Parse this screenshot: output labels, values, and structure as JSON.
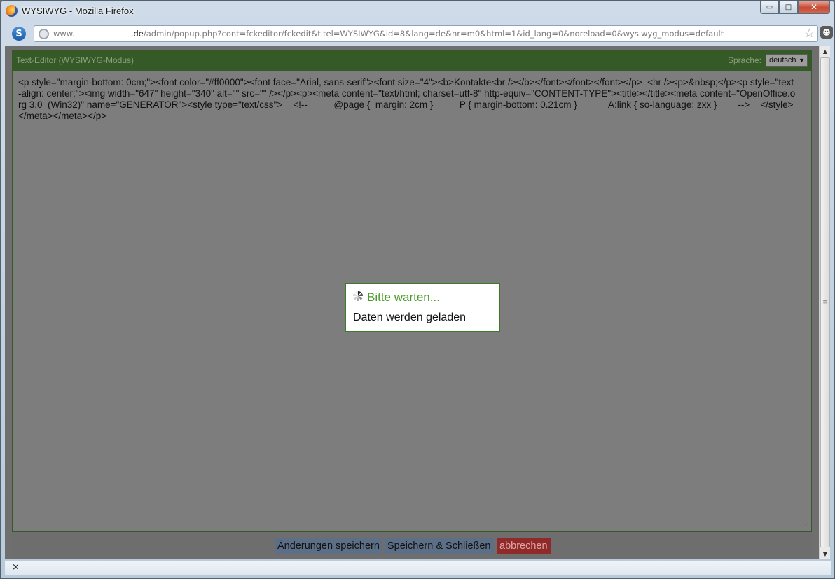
{
  "window": {
    "title": "WYSIWYG - Mozilla Firefox",
    "minimize_glyph": "▭",
    "maximize_glyph": "□",
    "close_glyph": "✕"
  },
  "navbar": {
    "url_prefix": "www.",
    "url_host": ".de",
    "url_path": "/admin/popup.php?cont=fckeditor/fckedit&titel=WYSIWYG&id=8&lang=de&nr=m0&html=1&id_lang=0&noreload=0&wysiwyg_modus=default",
    "site_icon_letter": "S",
    "bookmark_glyph": "☆"
  },
  "editor": {
    "title": "Text-Editor (WYSIWYG-Modus)",
    "language_label": "Sprache:",
    "language_value": "deutsch",
    "source_text": "<p style=\"margin-bottom: 0cm;\"><font color=\"#ff0000\"><font face=\"Arial, sans-serif\"><font size=\"4\"><b>Kontakte<br /></b></font></font></font></p>  <hr /><p>&nbsp;</p><p style=\"text-align: center;\"><img width=\"647\" height=\"340\" alt=\"\" src=\"\" /></p><p><meta content=\"text/html; charset=utf-8\" http-equiv=\"CONTENT-TYPE\"><title></title><meta content=\"OpenOffice.org 3.0  (Win32)\" name=\"GENERATOR\"><style type=\"text/css\">    <!--          @page {  margin: 2cm }          P { margin-bottom: 0.21cm }            A:link { so-language: zxx }        -->    </style></meta></meta></p>",
    "buttons": {
      "save": "Änderungen speichern",
      "save_close": "Speichern & Schließen",
      "cancel": "abbrechen"
    }
  },
  "loading": {
    "title": "Bitte warten...",
    "message": "Daten werden geladen"
  },
  "statusbar": {
    "close_glyph": "×"
  }
}
